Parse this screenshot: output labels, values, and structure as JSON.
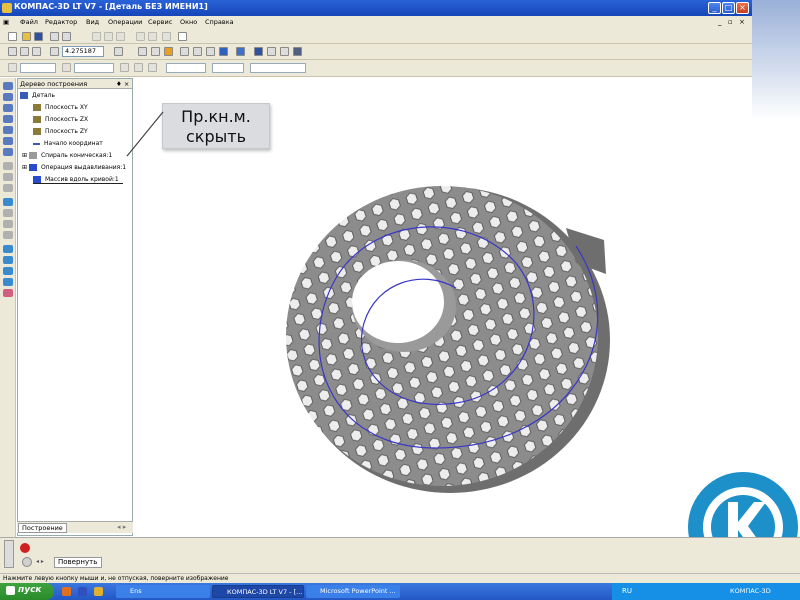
{
  "window": {
    "title": "КОМПАС-3D LT V7 - [Деталь БЕЗ ИМЕНИ1]"
  },
  "menu": [
    "Файл",
    "Редактор",
    "Вид",
    "Операции",
    "Сервис",
    "Окно",
    "Справка"
  ],
  "toolbar": {
    "zoom_value": "4.275187"
  },
  "tree": {
    "header": "Дерево построения",
    "header_controls": "♦ ×",
    "items": [
      "Деталь",
      "Плоскость XY",
      "Плоскость ZX",
      "Плоскость ZY",
      "Начало координат",
      "Спираль коническая:1",
      "Операция выдавливания:1",
      "Массив вдоль кривой:1"
    ],
    "tab": "Построение"
  },
  "callout": {
    "line1": "Пр.кн.м.",
    "line2": "скрыть"
  },
  "props": {
    "tab": "Повернуть"
  },
  "status": {
    "text": "Нажмите левую кнопку мыши и, не отпуская, поверните изображение"
  },
  "taskbar": {
    "start": "пуск",
    "items": [
      "Ens",
      "КОМПАС-3D LT V7 - [...]",
      "Microsoft PowerPoint ..."
    ],
    "lang": "RU",
    "tray": "КОМПАС-3D"
  },
  "colors": {
    "titlebar": "#2a62d8",
    "taskbar": "#3b78e0",
    "start": "#3ea33e",
    "model": "#808080",
    "spiral": "#3a36c8",
    "logo": "#1d8fc9"
  }
}
